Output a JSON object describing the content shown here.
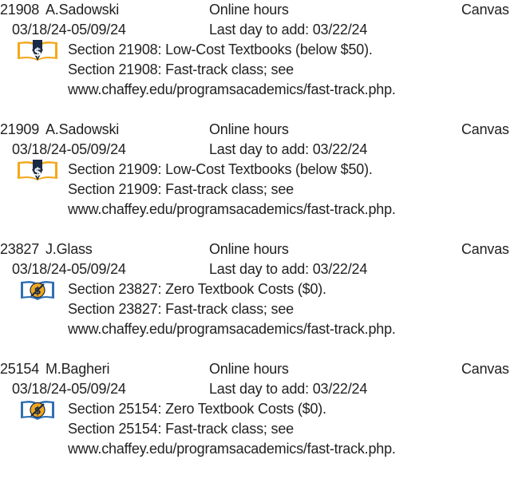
{
  "sections": [
    {
      "section": "21908",
      "instructor": "A.Sadowski",
      "hours": "Online hours",
      "mode": "Canvas",
      "dates": "03/18/24-05/09/24",
      "last_day_to_add": "Last day to add: 03/22/24",
      "badge_icon": "low-cost-textbook-icon",
      "note_textbook": "Section 21908: Low-Cost Textbooks (below $50).",
      "note_fasttrack": "Section 21908: Fast-track class; see",
      "note_url": "www.chaffey.edu/programsacademics/fast-track.php."
    },
    {
      "section": "21909",
      "instructor": "A.Sadowski",
      "hours": "Online hours",
      "mode": "Canvas",
      "dates": "03/18/24-05/09/24",
      "last_day_to_add": "Last day to add: 03/22/24",
      "badge_icon": "low-cost-textbook-icon",
      "note_textbook": "Section 21909: Low-Cost Textbooks (below $50).",
      "note_fasttrack": "Section 21909: Fast-track class; see",
      "note_url": "www.chaffey.edu/programsacademics/fast-track.php."
    },
    {
      "section": "23827",
      "instructor": "J.Glass",
      "hours": "Online hours",
      "mode": "Canvas",
      "dates": "03/18/24-05/09/24",
      "last_day_to_add": "Last day to add: 03/22/24",
      "badge_icon": "zero-textbook-cost-icon",
      "note_textbook": "Section 23827: Zero Textbook Costs ($0).",
      "note_fasttrack": "Section 23827: Fast-track class; see",
      "note_url": "www.chaffey.edu/programsacademics/fast-track.php."
    },
    {
      "section": "25154",
      "instructor": "M.Bagheri",
      "hours": "Online hours",
      "mode": "Canvas",
      "dates": "03/18/24-05/09/24",
      "last_day_to_add": "Last day to add: 03/22/24",
      "badge_icon": "zero-textbook-cost-icon",
      "note_textbook": "Section 25154: Zero Textbook Costs ($0).",
      "note_fasttrack": "Section 25154: Fast-track class; see",
      "note_url": "www.chaffey.edu/programsacademics/fast-track.php."
    }
  ],
  "colors": {
    "text": "#222222",
    "badge_blue": "#2f6fb3",
    "badge_gold": "#f2a81d",
    "badge_dark": "#1b2a44"
  }
}
